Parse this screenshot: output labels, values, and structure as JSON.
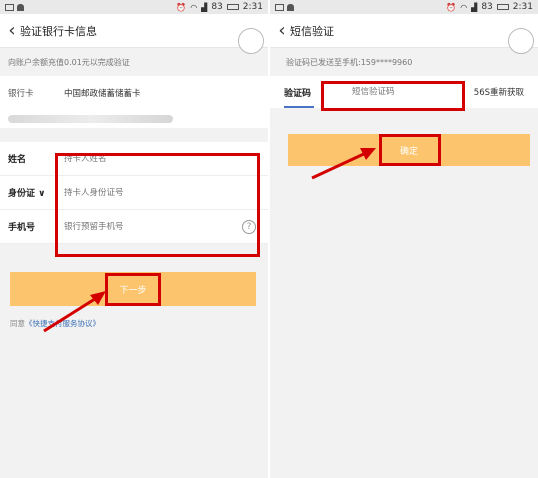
{
  "left": {
    "status": {
      "time": "2:31",
      "battery": "83"
    },
    "title": "验证银行卡信息",
    "notice": "向账户余额充值0.01元以完成验证",
    "card_label": "银行卡",
    "card_value": "中国邮政储蓄储蓄卡",
    "fields": [
      {
        "label": "姓名",
        "placeholder": "持卡人姓名"
      },
      {
        "label": "身份证 ∨",
        "placeholder": "持卡人身份证号"
      },
      {
        "label": "手机号",
        "placeholder": "银行预留手机号"
      }
    ],
    "next_button": "下一步",
    "agree_prefix": "同意",
    "agree_link": "《快捷支付服务协议》"
  },
  "right": {
    "status": {
      "time": "2:31",
      "battery": "83"
    },
    "title": "短信验证",
    "notice": "验证码已发送至手机:159****9960",
    "code_label": "验证码",
    "code_placeholder": "短信验证码",
    "resend": "56S重新获取",
    "confirm_button": "确定"
  },
  "colors": {
    "accent": "#fcc56d",
    "highlight": "#d40000",
    "link": "#3b6fb6"
  },
  "icons": [
    "back-arrow-icon",
    "wifi-icon",
    "signal-icon",
    "battery-icon",
    "help-icon",
    "pointer-arrow-icon"
  ]
}
